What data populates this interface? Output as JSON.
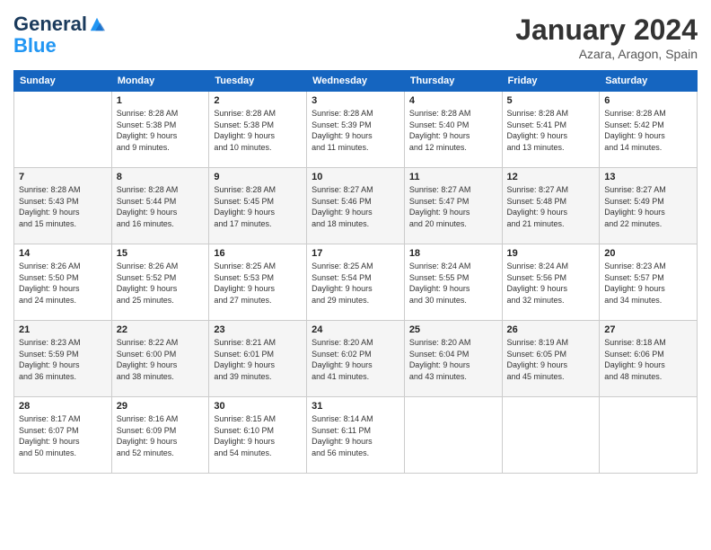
{
  "logo": {
    "line1": "General",
    "line2": "Blue"
  },
  "title": "January 2024",
  "subtitle": "Azara, Aragon, Spain",
  "headers": [
    "Sunday",
    "Monday",
    "Tuesday",
    "Wednesday",
    "Thursday",
    "Friday",
    "Saturday"
  ],
  "weeks": [
    [
      {
        "day": "",
        "info": ""
      },
      {
        "day": "1",
        "info": "Sunrise: 8:28 AM\nSunset: 5:38 PM\nDaylight: 9 hours\nand 9 minutes."
      },
      {
        "day": "2",
        "info": "Sunrise: 8:28 AM\nSunset: 5:38 PM\nDaylight: 9 hours\nand 10 minutes."
      },
      {
        "day": "3",
        "info": "Sunrise: 8:28 AM\nSunset: 5:39 PM\nDaylight: 9 hours\nand 11 minutes."
      },
      {
        "day": "4",
        "info": "Sunrise: 8:28 AM\nSunset: 5:40 PM\nDaylight: 9 hours\nand 12 minutes."
      },
      {
        "day": "5",
        "info": "Sunrise: 8:28 AM\nSunset: 5:41 PM\nDaylight: 9 hours\nand 13 minutes."
      },
      {
        "day": "6",
        "info": "Sunrise: 8:28 AM\nSunset: 5:42 PM\nDaylight: 9 hours\nand 14 minutes."
      }
    ],
    [
      {
        "day": "7",
        "info": "Sunrise: 8:28 AM\nSunset: 5:43 PM\nDaylight: 9 hours\nand 15 minutes."
      },
      {
        "day": "8",
        "info": "Sunrise: 8:28 AM\nSunset: 5:44 PM\nDaylight: 9 hours\nand 16 minutes."
      },
      {
        "day": "9",
        "info": "Sunrise: 8:28 AM\nSunset: 5:45 PM\nDaylight: 9 hours\nand 17 minutes."
      },
      {
        "day": "10",
        "info": "Sunrise: 8:27 AM\nSunset: 5:46 PM\nDaylight: 9 hours\nand 18 minutes."
      },
      {
        "day": "11",
        "info": "Sunrise: 8:27 AM\nSunset: 5:47 PM\nDaylight: 9 hours\nand 20 minutes."
      },
      {
        "day": "12",
        "info": "Sunrise: 8:27 AM\nSunset: 5:48 PM\nDaylight: 9 hours\nand 21 minutes."
      },
      {
        "day": "13",
        "info": "Sunrise: 8:27 AM\nSunset: 5:49 PM\nDaylight: 9 hours\nand 22 minutes."
      }
    ],
    [
      {
        "day": "14",
        "info": "Sunrise: 8:26 AM\nSunset: 5:50 PM\nDaylight: 9 hours\nand 24 minutes."
      },
      {
        "day": "15",
        "info": "Sunrise: 8:26 AM\nSunset: 5:52 PM\nDaylight: 9 hours\nand 25 minutes."
      },
      {
        "day": "16",
        "info": "Sunrise: 8:25 AM\nSunset: 5:53 PM\nDaylight: 9 hours\nand 27 minutes."
      },
      {
        "day": "17",
        "info": "Sunrise: 8:25 AM\nSunset: 5:54 PM\nDaylight: 9 hours\nand 29 minutes."
      },
      {
        "day": "18",
        "info": "Sunrise: 8:24 AM\nSunset: 5:55 PM\nDaylight: 9 hours\nand 30 minutes."
      },
      {
        "day": "19",
        "info": "Sunrise: 8:24 AM\nSunset: 5:56 PM\nDaylight: 9 hours\nand 32 minutes."
      },
      {
        "day": "20",
        "info": "Sunrise: 8:23 AM\nSunset: 5:57 PM\nDaylight: 9 hours\nand 34 minutes."
      }
    ],
    [
      {
        "day": "21",
        "info": "Sunrise: 8:23 AM\nSunset: 5:59 PM\nDaylight: 9 hours\nand 36 minutes."
      },
      {
        "day": "22",
        "info": "Sunrise: 8:22 AM\nSunset: 6:00 PM\nDaylight: 9 hours\nand 38 minutes."
      },
      {
        "day": "23",
        "info": "Sunrise: 8:21 AM\nSunset: 6:01 PM\nDaylight: 9 hours\nand 39 minutes."
      },
      {
        "day": "24",
        "info": "Sunrise: 8:20 AM\nSunset: 6:02 PM\nDaylight: 9 hours\nand 41 minutes."
      },
      {
        "day": "25",
        "info": "Sunrise: 8:20 AM\nSunset: 6:04 PM\nDaylight: 9 hours\nand 43 minutes."
      },
      {
        "day": "26",
        "info": "Sunrise: 8:19 AM\nSunset: 6:05 PM\nDaylight: 9 hours\nand 45 minutes."
      },
      {
        "day": "27",
        "info": "Sunrise: 8:18 AM\nSunset: 6:06 PM\nDaylight: 9 hours\nand 48 minutes."
      }
    ],
    [
      {
        "day": "28",
        "info": "Sunrise: 8:17 AM\nSunset: 6:07 PM\nDaylight: 9 hours\nand 50 minutes."
      },
      {
        "day": "29",
        "info": "Sunrise: 8:16 AM\nSunset: 6:09 PM\nDaylight: 9 hours\nand 52 minutes."
      },
      {
        "day": "30",
        "info": "Sunrise: 8:15 AM\nSunset: 6:10 PM\nDaylight: 9 hours\nand 54 minutes."
      },
      {
        "day": "31",
        "info": "Sunrise: 8:14 AM\nSunset: 6:11 PM\nDaylight: 9 hours\nand 56 minutes."
      },
      {
        "day": "",
        "info": ""
      },
      {
        "day": "",
        "info": ""
      },
      {
        "day": "",
        "info": ""
      }
    ]
  ]
}
